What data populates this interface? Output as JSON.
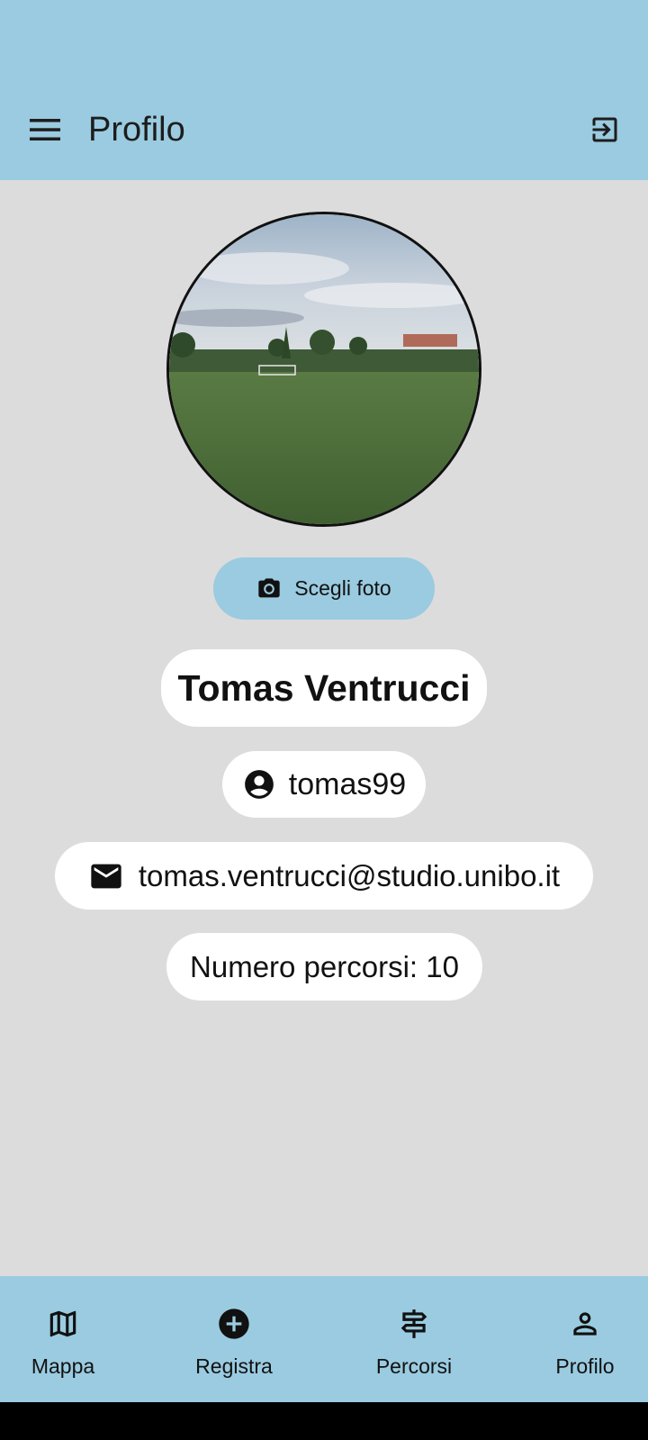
{
  "header": {
    "title": "Profilo",
    "menu_icon": "menu-icon",
    "logout_icon": "logout-icon"
  },
  "profile": {
    "change_photo_label": "Scegli foto",
    "full_name": "Tomas Ventrucci",
    "username": "tomas99",
    "email": "tomas.ventrucci@studio.unibo.it",
    "routes_count_text": "Numero percorsi: 10"
  },
  "bottom_nav": {
    "items": [
      {
        "label": "Mappa",
        "icon": "map-icon"
      },
      {
        "label": "Registra",
        "icon": "add-circle-icon"
      },
      {
        "label": "Percorsi",
        "icon": "signpost-icon"
      },
      {
        "label": "Profilo",
        "icon": "person-icon"
      }
    ]
  },
  "colors": {
    "primary": "#9acbe0",
    "background": "#dcdcdc",
    "card": "#ffffff",
    "text": "#111111"
  }
}
